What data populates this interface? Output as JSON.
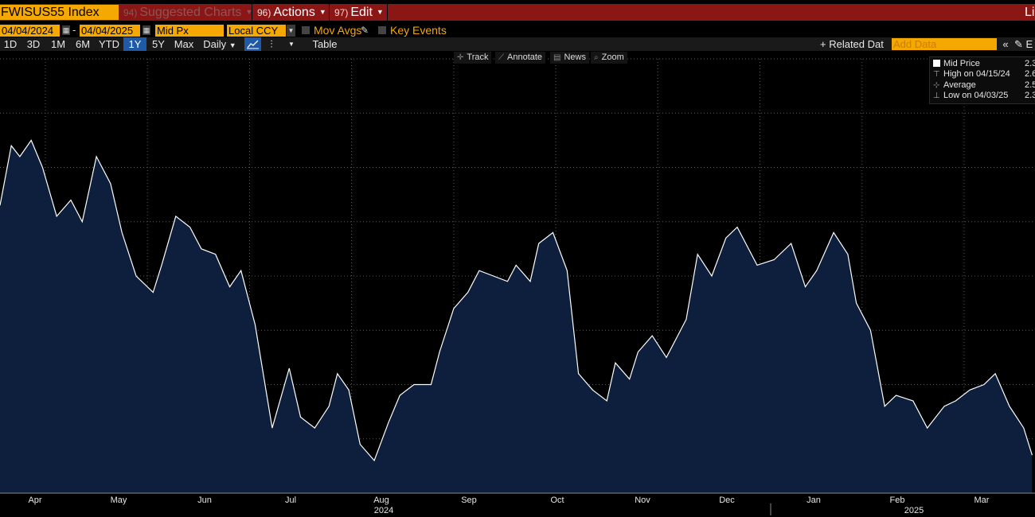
{
  "header": {
    "ticker": "FWISUS55 Index",
    "menus": [
      {
        "num": "94)",
        "label": "Suggested Charts"
      },
      {
        "num": "96)",
        "label": "Actions"
      },
      {
        "num": "97)",
        "label": "Edit"
      }
    ],
    "right_label": "Li"
  },
  "controls": {
    "start_date": "04/04/2024",
    "end_date": "04/04/2025",
    "dash": "-",
    "field": "Mid Px",
    "currency": "Local CCY",
    "mov_avgs": "Mov Avgs",
    "key_events": "Key Events",
    "periods": [
      "1D",
      "3D",
      "1M",
      "6M",
      "YTD",
      "1Y",
      "5Y",
      "Max"
    ],
    "active_period": "1Y",
    "frequency": "Daily",
    "table": "Table",
    "related": "+ Related Dat",
    "add_data": "Add Data",
    "edit_short": "E"
  },
  "toolbar": {
    "track": "Track",
    "annotate": "Annotate",
    "news": "News",
    "zoom": "Zoom"
  },
  "legend": {
    "mid_price_label": "Mid Price",
    "mid_price_value": "2.3",
    "high_label": "High on 04/15/24",
    "high_value": "2.6",
    "average_label": "Average",
    "average_value": "2.5",
    "low_label": "Low on 04/03/25",
    "low_value": "2.3"
  },
  "colors": {
    "background": "#000000",
    "area_fill": "#0d1f3c",
    "line": "#ffffff",
    "grid": "#5a5a5a",
    "accent_orange": "#f5a800",
    "menu_red": "#8a1616",
    "active_blue": "#1e5aa8"
  },
  "chart_data": {
    "type": "area",
    "title": "",
    "xlabel": "",
    "ylabel": "",
    "series": [
      {
        "name": "Mid Price",
        "x": [
          "2024-04-04",
          "2024-04-08",
          "2024-04-11",
          "2024-04-15",
          "2024-04-19",
          "2024-04-24",
          "2024-04-29",
          "2024-05-03",
          "2024-05-08",
          "2024-05-13",
          "2024-05-17",
          "2024-05-22",
          "2024-05-28",
          "2024-05-31",
          "2024-06-05",
          "2024-06-10",
          "2024-06-14",
          "2024-06-19",
          "2024-06-24",
          "2024-06-28",
          "2024-07-03",
          "2024-07-09",
          "2024-07-15",
          "2024-07-19",
          "2024-07-24",
          "2024-07-29",
          "2024-08-01",
          "2024-08-05",
          "2024-08-09",
          "2024-08-14",
          "2024-08-19",
          "2024-08-23",
          "2024-08-28",
          "2024-09-03",
          "2024-09-06",
          "2024-09-11",
          "2024-09-16",
          "2024-09-20",
          "2024-09-25",
          "2024-09-30",
          "2024-10-03",
          "2024-10-08",
          "2024-10-11",
          "2024-10-16",
          "2024-10-21",
          "2024-10-25",
          "2024-10-30",
          "2024-11-04",
          "2024-11-07",
          "2024-11-12",
          "2024-11-15",
          "2024-11-20",
          "2024-11-25",
          "2024-12-02",
          "2024-12-06",
          "2024-12-11",
          "2024-12-16",
          "2024-12-20",
          "2024-12-27",
          "2025-01-02",
          "2025-01-08",
          "2025-01-13",
          "2025-01-17",
          "2025-01-23",
          "2025-01-28",
          "2025-01-31",
          "2025-02-05",
          "2025-02-10",
          "2025-02-14",
          "2025-02-20",
          "2025-02-25",
          "2025-03-03",
          "2025-03-07",
          "2025-03-12",
          "2025-03-17",
          "2025-03-21",
          "2025-03-26",
          "2025-03-31",
          "2025-04-03"
        ],
        "y": [
          2.565,
          2.62,
          2.61,
          2.625,
          2.6,
          2.555,
          2.57,
          2.55,
          2.61,
          2.585,
          2.54,
          2.5,
          2.485,
          2.51,
          2.555,
          2.545,
          2.525,
          2.52,
          2.49,
          2.505,
          2.455,
          2.36,
          2.415,
          2.37,
          2.36,
          2.38,
          2.41,
          2.395,
          2.345,
          2.33,
          2.365,
          2.39,
          2.4,
          2.4,
          2.43,
          2.47,
          2.485,
          2.505,
          2.5,
          2.495,
          2.51,
          2.495,
          2.53,
          2.54,
          2.505,
          2.41,
          2.395,
          2.385,
          2.42,
          2.405,
          2.43,
          2.445,
          2.425,
          2.46,
          2.52,
          2.5,
          2.535,
          2.545,
          2.51,
          2.515,
          2.53,
          2.49,
          2.505,
          2.54,
          2.52,
          2.475,
          2.45,
          2.38,
          2.39,
          2.385,
          2.36,
          2.38,
          2.385,
          2.395,
          2.4,
          2.41,
          2.38,
          2.36,
          2.335
        ]
      }
    ],
    "ylim": [
      2.3,
      2.7
    ],
    "x_tick_labels": [
      "Apr",
      "May",
      "Jun",
      "Jul",
      "Aug",
      "Sep",
      "Oct",
      "Nov",
      "Dec",
      "Jan",
      "Feb",
      "Mar"
    ],
    "year_labels": [
      "2024",
      "2025"
    ],
    "grid": true,
    "legend_position": "top-right"
  }
}
